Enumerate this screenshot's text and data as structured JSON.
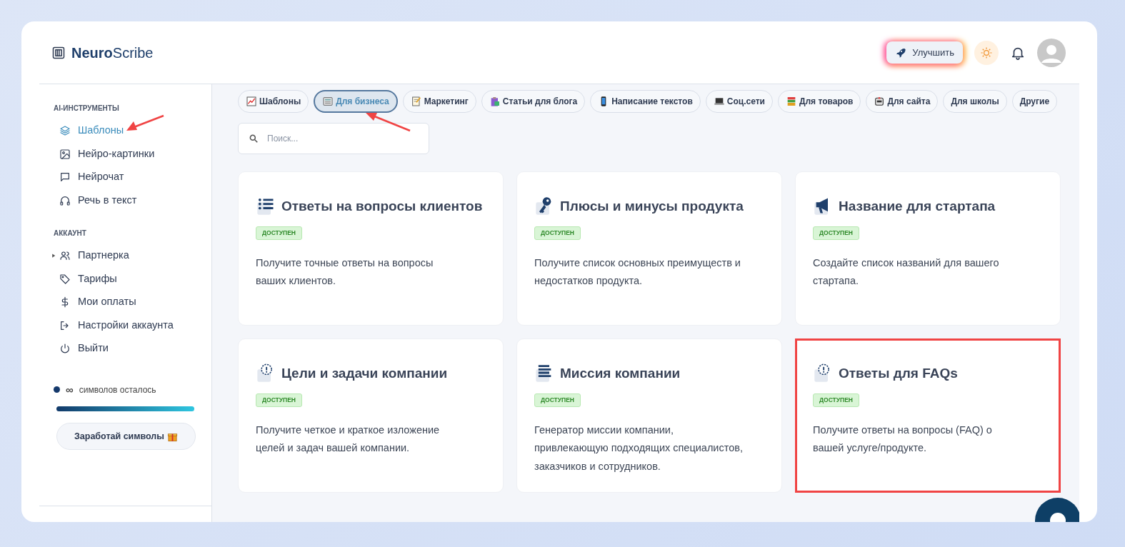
{
  "brand": {
    "name_bold": "Neuro",
    "name_light": "Scribe"
  },
  "header": {
    "upgrade_button": "Улучшить"
  },
  "sidebar": {
    "sections": [
      {
        "title": "AI-ИНСТРУМЕНТЫ",
        "items": [
          {
            "label": "Шаблоны",
            "selected": true,
            "annotated": true,
            "expandable": false
          },
          {
            "label": "Нейро-картинки",
            "selected": false,
            "annotated": false,
            "expandable": false
          },
          {
            "label": "Нейрочат",
            "selected": false,
            "annotated": false,
            "expandable": false
          },
          {
            "label": "Речь в текст",
            "selected": false,
            "annotated": false,
            "expandable": false
          }
        ]
      },
      {
        "title": "АККАУНТ",
        "items": [
          {
            "label": "Партнерка",
            "selected": false,
            "annotated": false,
            "expandable": true
          },
          {
            "label": "Тарифы",
            "selected": false,
            "annotated": false,
            "expandable": false
          },
          {
            "label": "Мои оплаты",
            "selected": false,
            "annotated": false,
            "expandable": false
          },
          {
            "label": "Настройки аккаунта",
            "selected": false,
            "annotated": false,
            "expandable": false
          },
          {
            "label": "Выйти",
            "selected": false,
            "annotated": false,
            "expandable": false
          }
        ]
      }
    ],
    "credits": {
      "amount": "∞",
      "label": "символов осталось",
      "level": 1
    },
    "earn_button": "Заработай символы"
  },
  "categories": [
    {
      "label": "Шаблоны",
      "selected": false,
      "annotated": false
    },
    {
      "label": "Для бизнеса",
      "selected": true,
      "annotated": true
    },
    {
      "label": "Маркетинг",
      "selected": false,
      "annotated": false
    },
    {
      "label": "Статьи для блога",
      "selected": false,
      "annotated": false
    },
    {
      "label": "Написание текстов",
      "selected": false,
      "annotated": false
    },
    {
      "label": "Соц.сети",
      "selected": false,
      "annotated": false
    },
    {
      "label": "Для товаров",
      "selected": false,
      "annotated": false
    },
    {
      "label": "Для сайта",
      "selected": false,
      "annotated": false
    },
    {
      "label": "Для школы",
      "selected": false,
      "annotated": false
    },
    {
      "label": "Другие",
      "selected": false,
      "annotated": false
    }
  ],
  "search": {
    "placeholder": "Поиск..."
  },
  "templates": [
    {
      "title": "Ответы на вопросы клиентов",
      "status": "ДОСТУПЕН",
      "description": "Получите точные ответы на вопросы ваших клиентов.",
      "highlighted": false
    },
    {
      "title": "Плюсы и минусы продукта",
      "status": "ДОСТУПЕН",
      "description": "Получите список основных преимуществ и недостатков продукта.",
      "highlighted": false
    },
    {
      "title": "Название для стартапа",
      "status": "ДОСТУПЕН",
      "description": "Создайте список названий для вашего стартапа.",
      "highlighted": false
    },
    {
      "title": "Цели и задачи компании",
      "status": "ДОСТУПЕН",
      "description": "Получите четкое и краткое изложение целей и задач вашей компании.",
      "highlighted": false
    },
    {
      "title": "Миссия компании",
      "status": "ДОСТУПЕН",
      "description": "Генератор миссии компании, привлекающую подходящих специалистов, заказчиков и сотрудников.",
      "highlighted": false
    },
    {
      "title": "Ответы для FAQs",
      "status": "ДОСТУПЕН",
      "description": "Получите ответы на вопросы (FAQ) о вашей услуге/продукте.",
      "highlighted": true
    }
  ]
}
